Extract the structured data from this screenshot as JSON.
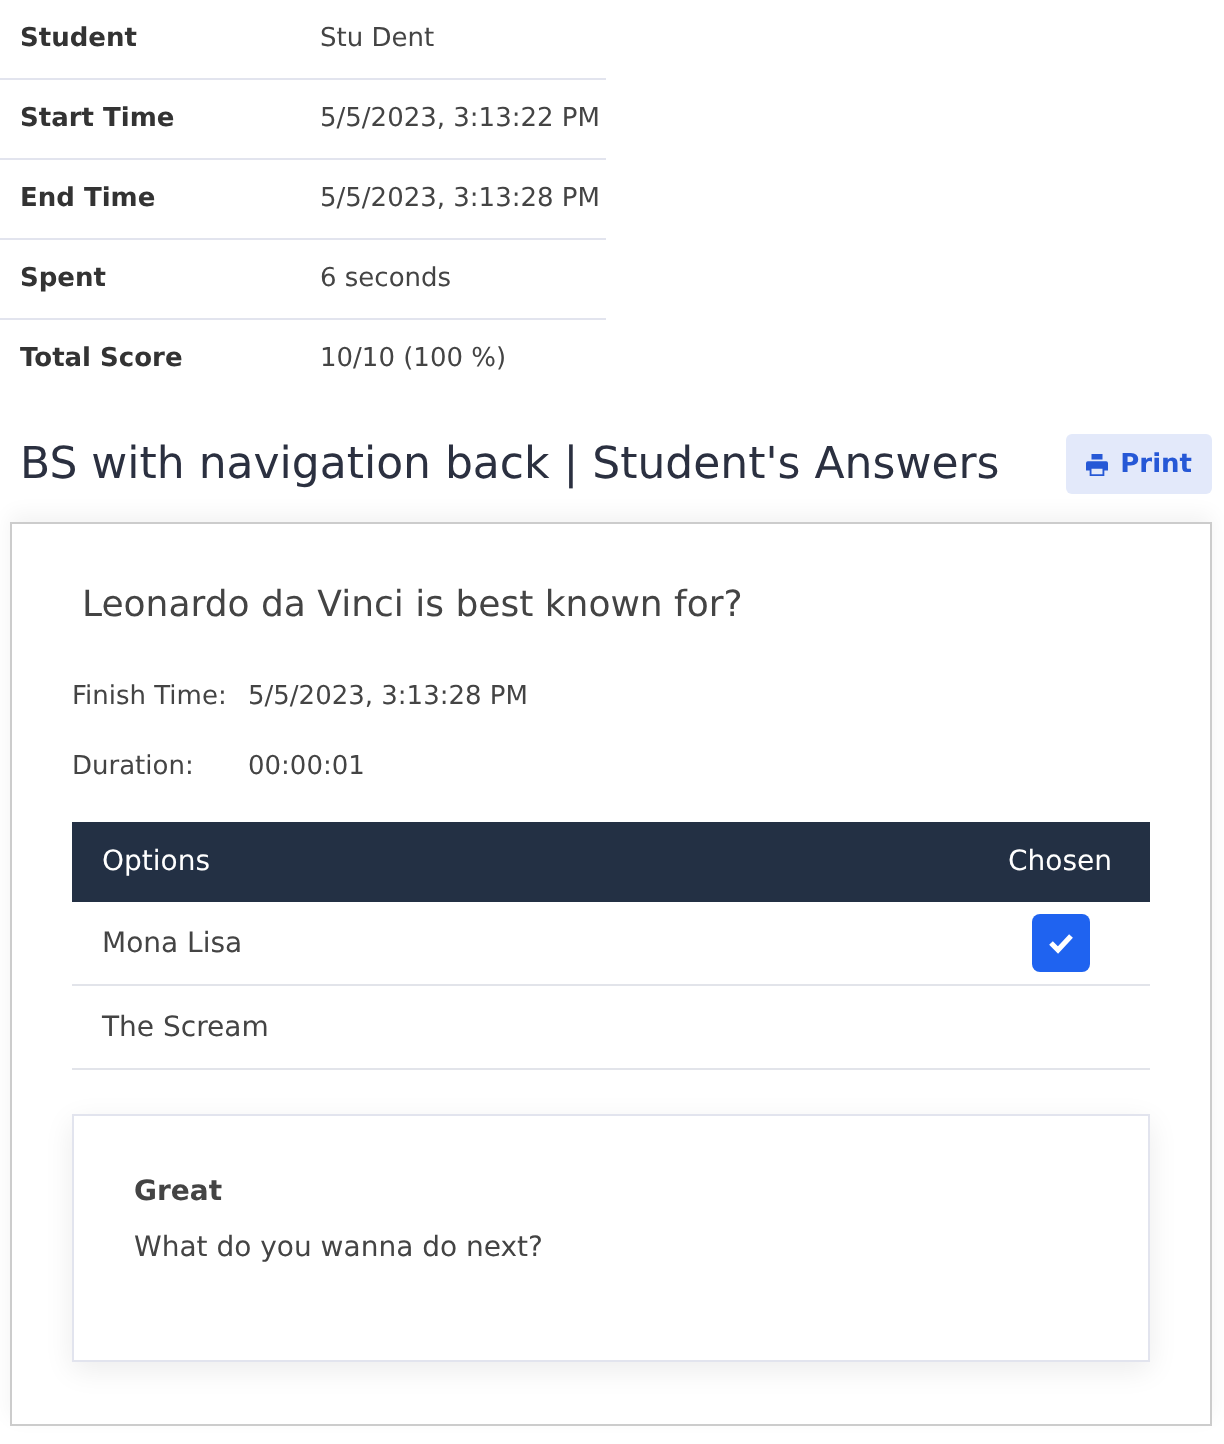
{
  "summary": [
    {
      "label": "Student",
      "value": "Stu Dent"
    },
    {
      "label": "Start Time",
      "value": "5/5/2023, 3:13:22 PM"
    },
    {
      "label": "End Time",
      "value": "5/5/2023, 3:13:28 PM"
    },
    {
      "label": "Spent",
      "value": "6 seconds"
    },
    {
      "label": "Total Score",
      "value": "10/10 (100 %)"
    }
  ],
  "heading": {
    "title": "BS with navigation back | Student's Answers",
    "print_button": "Print"
  },
  "question": {
    "text": "Leonardo da Vinci is best known for?",
    "details": [
      {
        "label": "Finish Time:",
        "value": "5/5/2023, 3:13:28 PM"
      },
      {
        "label": "Duration:",
        "value": "00:00:01"
      }
    ],
    "table": {
      "columns": [
        "Options",
        "Chosen"
      ],
      "rows": [
        {
          "option": "Mona Lisa",
          "chosen": true
        },
        {
          "option": "The Scream",
          "chosen": false
        }
      ]
    },
    "feedback": {
      "title": "Great",
      "message": "What do you wanna do next?"
    }
  }
}
